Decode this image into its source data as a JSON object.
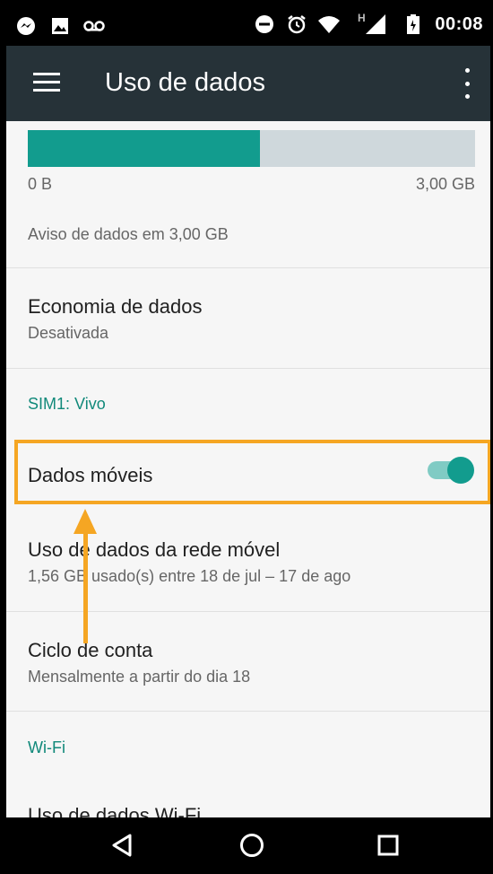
{
  "status_bar": {
    "time": "00:08",
    "network_label": "H",
    "left_icons": [
      "messenger-icon",
      "image-icon",
      "voicemail-icon"
    ],
    "right_icons": [
      "do-not-disturb-icon",
      "alarm-icon",
      "wifi-icon",
      "cell-signal-icon",
      "battery-icon"
    ]
  },
  "app_bar": {
    "title": "Uso de dados",
    "menu_icon": "menu-icon",
    "overflow_icon": "more-vert-icon"
  },
  "usage": {
    "min_label": "0 B",
    "max_label": "3,00 GB",
    "fill_fraction": 0.52,
    "warning": "Aviso de dados em 3,00 GB"
  },
  "items": {
    "data_saver": {
      "title": "Economia de dados",
      "subtitle": "Desativada"
    },
    "sim_section": "SIM1: Vivo",
    "mobile_data": {
      "title": "Dados móveis",
      "enabled": true
    },
    "mobile_usage": {
      "title": "Uso de dados da rede móvel",
      "subtitle": "1,56 GB usado(s) entre 18 de jul – 17 de ago"
    },
    "billing_cycle": {
      "title": "Ciclo de conta",
      "subtitle": "Mensalmente a partir do dia 18"
    },
    "wifi_section": "Wi-Fi",
    "wifi_usage": {
      "title": "Uso de dados Wi-Fi"
    }
  },
  "nav_bar": {
    "buttons": [
      "back-icon",
      "home-icon",
      "recents-icon"
    ]
  },
  "colors": {
    "accent": "#129c8e",
    "toolbar": "#263238",
    "highlight": "#f5a623"
  }
}
